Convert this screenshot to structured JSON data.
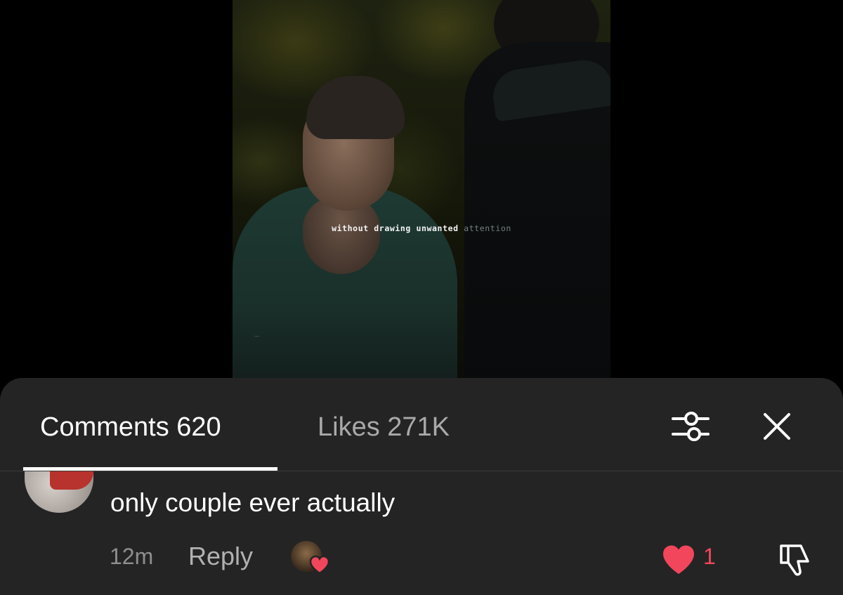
{
  "video": {
    "caption_main": "without drawing unwanted",
    "caption_faded": "attention"
  },
  "comments_sheet": {
    "tabs": [
      {
        "label": "Comments 620",
        "active": true
      },
      {
        "label": "Likes 271K",
        "active": false
      }
    ],
    "comment": {
      "text": "only couple ever actually",
      "time": "12m",
      "reply_label": "Reply",
      "like_count": "1",
      "liked_by_creator": true
    },
    "colors": {
      "sheet_background": "#242424",
      "like_red": "#f1465c",
      "active_tab": "#ffffff",
      "inactive_tab": "#a9a9a9"
    },
    "icons": [
      "filter-sliders-icon",
      "close-icon",
      "heart-icon",
      "dislike-icon"
    ]
  }
}
